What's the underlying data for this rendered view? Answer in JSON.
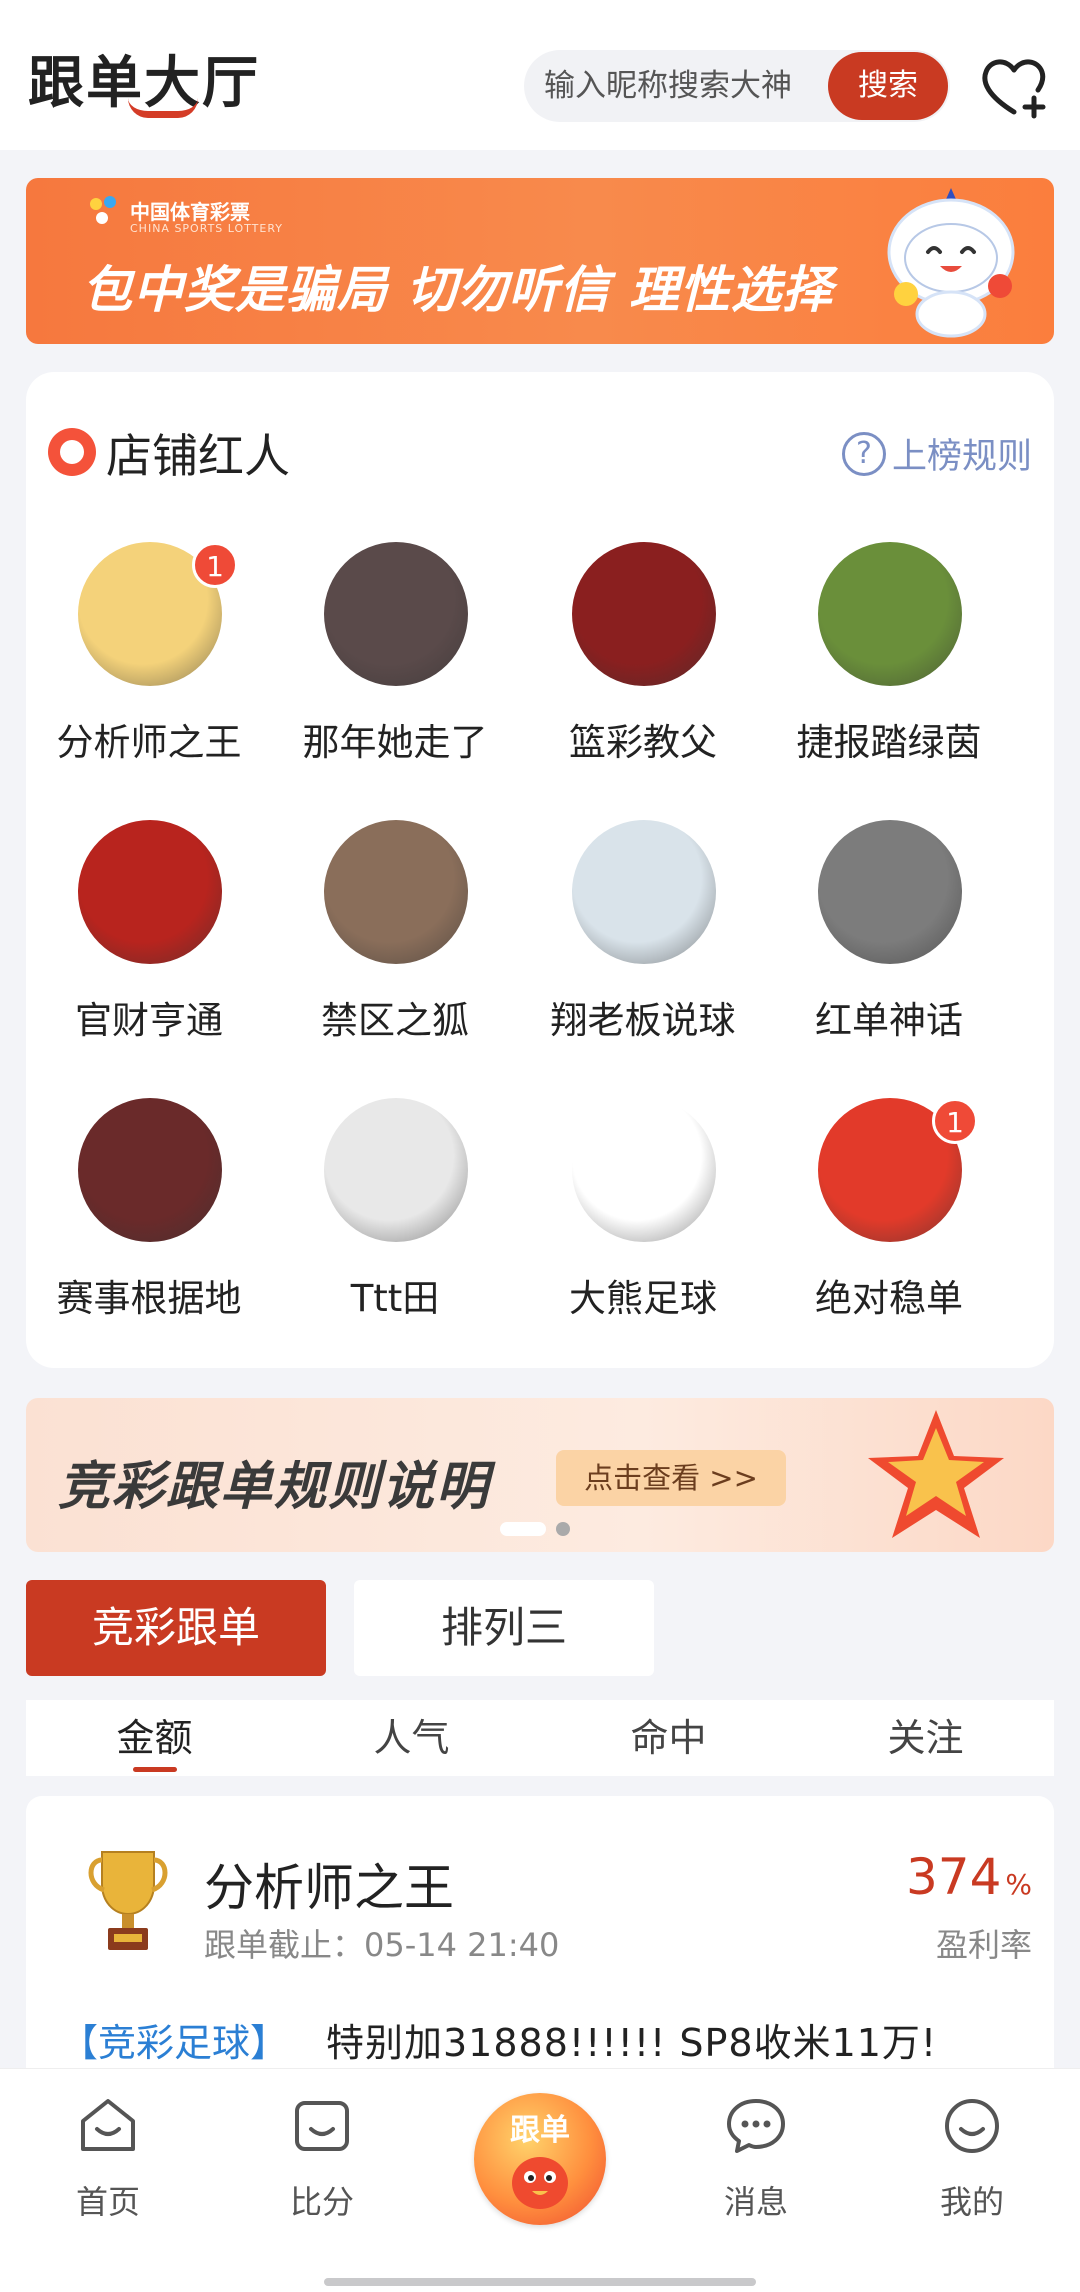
{
  "header": {
    "logo": "跟单大厅",
    "search_placeholder": "输入昵称搜索大神",
    "search_button": "搜索",
    "fav_icon": "heart-plus-icon"
  },
  "promo_banner": {
    "brand_cn": "中国体育彩票",
    "brand_en": "CHINA SPORTS LOTTERY",
    "text": "包中奖是骗局 切勿听信 理性选择"
  },
  "influencers": {
    "title": "店铺红人",
    "rules": "上榜规则",
    "items": [
      {
        "name": "分析师之王",
        "badge": "1",
        "color": "#f4d27a"
      },
      {
        "name": "那年她走了",
        "badge": "",
        "color": "#5a4a4a"
      },
      {
        "name": "篮彩教父",
        "badge": "",
        "color": "#8a1f1f"
      },
      {
        "name": "捷报踏绿茵",
        "badge": "",
        "color": "#6a8f3a"
      },
      {
        "name": "官财亨通",
        "badge": "",
        "color": "#b8241e"
      },
      {
        "name": "禁区之狐",
        "badge": "",
        "color": "#8a6e5a"
      },
      {
        "name": "翔老板说球",
        "badge": "",
        "color": "#d9e3ea"
      },
      {
        "name": "红单神话",
        "badge": "",
        "color": "#7c7c7c"
      },
      {
        "name": "赛事根据地",
        "badge": "",
        "color": "#6a2a2a"
      },
      {
        "name": "Ttt田",
        "badge": "",
        "color": "#e8e8e8"
      },
      {
        "name": "大熊足球",
        "badge": "",
        "color": "#ffffff"
      },
      {
        "name": "绝对稳单",
        "badge": "1",
        "color": "#e23a2a"
      }
    ]
  },
  "rules_banner": {
    "text": "竞彩跟单规则说明",
    "button": "点击查看 >>"
  },
  "tabs": {
    "main": [
      "竞彩跟单",
      "排列三"
    ],
    "sub": [
      "金额",
      "人气",
      "命中",
      "关注"
    ]
  },
  "record": {
    "name": "分析师之王",
    "deadline": "跟单截止：05-14 21:40",
    "rate": "374",
    "rate_unit": "%",
    "rate_label": "盈利率",
    "category": "【竞彩足球】",
    "description": "特别加31888!!!!!! SP8收米11万!"
  },
  "bottom_nav": {
    "items": [
      "首页",
      "比分",
      "消息",
      "我的"
    ],
    "center": "跟单"
  }
}
